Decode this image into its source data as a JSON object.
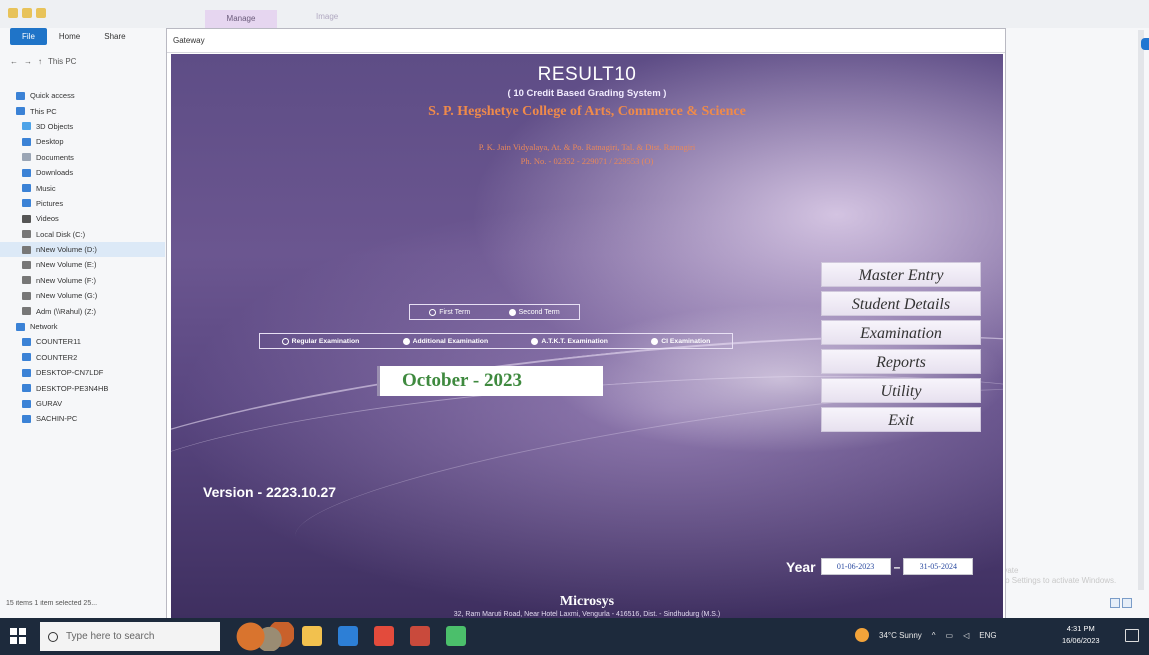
{
  "explorer": {
    "ribbon_tabs": [
      "File",
      "Home",
      "Share"
    ],
    "context_tab": "Manage",
    "context_tab2": "Image",
    "address": "This PC",
    "nav_items": [
      {
        "label": "Quick access",
        "icon": "star-icon",
        "color": "#3b82d6",
        "top": true
      },
      {
        "label": "This PC",
        "icon": "pc-icon",
        "color": "#3b82d6",
        "top": true
      },
      {
        "label": "3D Objects",
        "icon": "cube-icon",
        "color": "#4da3e8"
      },
      {
        "label": "Desktop",
        "icon": "desktop-icon",
        "color": "#3b82d6"
      },
      {
        "label": "Documents",
        "icon": "document-icon",
        "color": "#9aa5b5"
      },
      {
        "label": "Downloads",
        "icon": "download-icon",
        "color": "#3b82d6"
      },
      {
        "label": "Music",
        "icon": "music-icon",
        "color": "#3b82d6"
      },
      {
        "label": "Pictures",
        "icon": "picture-icon",
        "color": "#3b82d6"
      },
      {
        "label": "Videos",
        "icon": "video-icon",
        "color": "#555"
      },
      {
        "label": "Local Disk (C:)",
        "icon": "disk-icon",
        "color": "#777"
      },
      {
        "label": "nNew Volume (D:)",
        "icon": "disk-icon",
        "color": "#777",
        "selected": true
      },
      {
        "label": "nNew Volume (E:)",
        "icon": "disk-icon",
        "color": "#777"
      },
      {
        "label": "nNew Volume (F:)",
        "icon": "disk-icon",
        "color": "#777"
      },
      {
        "label": "nNew Volume (G:)",
        "icon": "disk-icon",
        "color": "#777"
      },
      {
        "label": "Adm (\\\\Rahul) (Z:)",
        "icon": "network-drive-icon",
        "color": "#777"
      },
      {
        "label": "Network",
        "icon": "network-icon",
        "color": "#3b82d6",
        "top": true
      },
      {
        "label": "COUNTER11",
        "icon": "computer-icon",
        "color": "#3b82d6"
      },
      {
        "label": "COUNTER2",
        "icon": "computer-icon",
        "color": "#3b82d6"
      },
      {
        "label": "DESKTOP-CN7LDF",
        "icon": "computer-icon",
        "color": "#3b82d6"
      },
      {
        "label": "DESKTOP-PE3N4HB",
        "icon": "computer-icon",
        "color": "#3b82d6"
      },
      {
        "label": "GURAV",
        "icon": "computer-icon",
        "color": "#3b82d6"
      },
      {
        "label": "SACHIN-PC",
        "icon": "computer-icon",
        "color": "#3b82d6"
      }
    ],
    "status": "15 items    1 item selected  25...",
    "watermark_line1": "Activate",
    "watermark_line2": "Go to Settings to activate Windows."
  },
  "window": {
    "title": "Gateway"
  },
  "app": {
    "title": "RESULT10",
    "subtitle": "( 10 Credit Based Grading System )",
    "college": "S. P. Hegshetye College of Arts, Commerce & Science",
    "address_line1": "P. K. Jain Vidyalaya, At. & Po. Ratnagiri, Tal. & Dist. Ratnagiri",
    "address_line2": "Ph. No. - 02352 - 229071 / 229553 (O)",
    "terms": [
      {
        "label": "First Term",
        "selected": false
      },
      {
        "label": "Second Term",
        "selected": true
      }
    ],
    "exams": [
      {
        "label": "Regular Examination",
        "selected": false
      },
      {
        "label": "Additional Examination",
        "selected": true
      },
      {
        "label": "A.T.K.T. Examination",
        "selected": true
      },
      {
        "label": "CI Examination",
        "selected": true
      }
    ],
    "session": "October - 2023",
    "menu": [
      "Master Entry",
      "Student Details",
      "Examination",
      "Reports",
      "Utility",
      "Exit"
    ],
    "version": "Version - 2223.10.27",
    "year_label": "Year",
    "year_from": "01-06-2023",
    "year_to": "31-05-2024",
    "company": "Microsys",
    "company_address": "32, Ram Maruti Road, Near Hotel Laxmi, Vengurla - 416516, Dist. - Sindhudurg (M.S.)"
  },
  "taskbar": {
    "search_placeholder": "Type here to search",
    "apps": [
      {
        "name": "file-explorer",
        "color": "#f2c14e"
      },
      {
        "name": "mail",
        "color": "#2d7fd6"
      },
      {
        "name": "chrome",
        "color": "#e34b3c"
      },
      {
        "name": "photos",
        "color": "#c94a3c"
      },
      {
        "name": "gateway",
        "color": "#4bbf6b"
      }
    ],
    "weather": "34°C  Sunny",
    "language": "ENG",
    "time": "4:31 PM",
    "date": "16/06/2023"
  }
}
